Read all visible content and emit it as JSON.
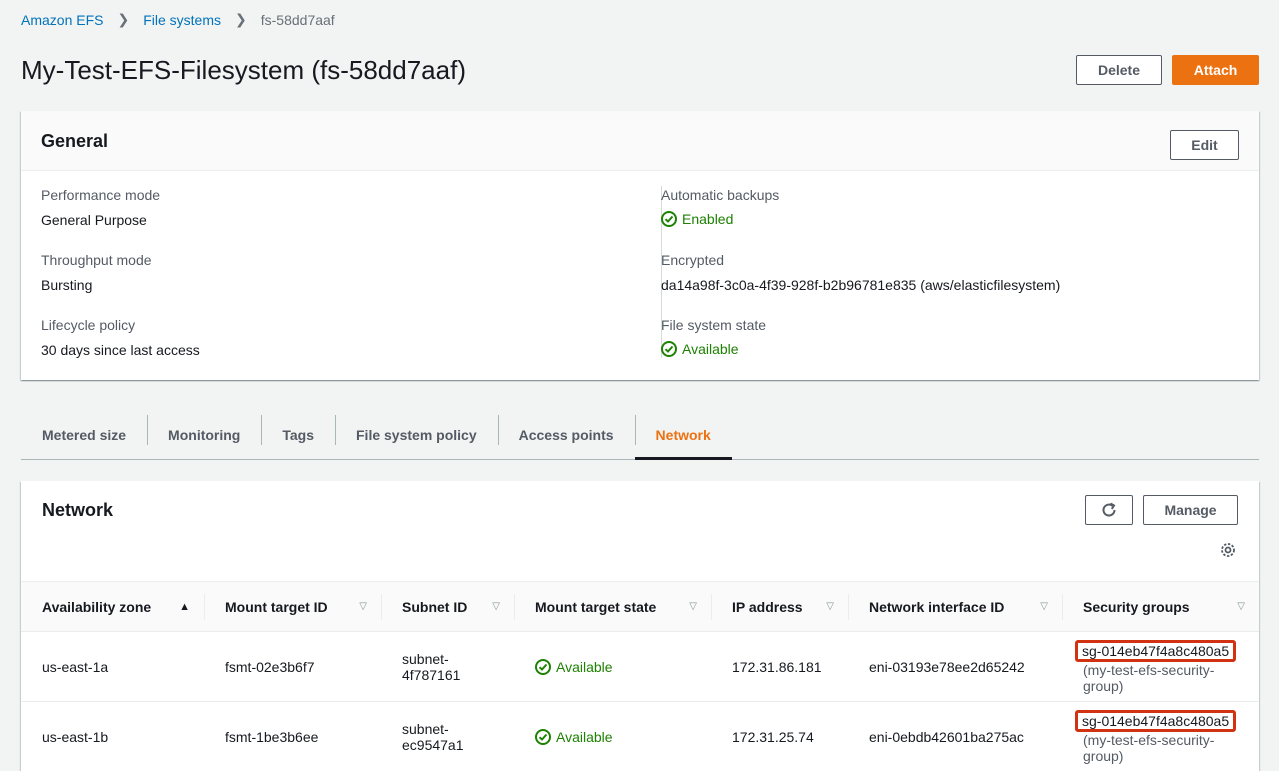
{
  "breadcrumb": [
    "Amazon EFS",
    "File systems",
    "fs-58dd7aaf"
  ],
  "title": "My-Test-EFS-Filesystem (fs-58dd7aaf)",
  "actions": {
    "delete": "Delete",
    "attach": "Attach",
    "edit": "Edit"
  },
  "general": {
    "heading": "General",
    "performance_label": "Performance mode",
    "performance_value": "General Purpose",
    "throughput_label": "Throughput mode",
    "throughput_value": "Bursting",
    "lifecycle_label": "Lifecycle policy",
    "lifecycle_value": "30 days since last access",
    "backups_label": "Automatic backups",
    "backups_value": "Enabled",
    "encrypted_label": "Encrypted",
    "encrypted_value": "da14a98f-3c0a-4f39-928f-b2b96781e835 (aws/elasticfilesystem)",
    "state_label": "File system state",
    "state_value": "Available"
  },
  "tabs": [
    "Metered size",
    "Monitoring",
    "Tags",
    "File system policy",
    "Access points",
    "Network"
  ],
  "active_tab": "Network",
  "network": {
    "heading": "Network",
    "manage": "Manage",
    "columns": [
      "Availability zone",
      "Mount target ID",
      "Subnet ID",
      "Mount target state",
      "IP address",
      "Network interface ID",
      "Security groups"
    ],
    "rows": [
      {
        "az": "us-east-1a",
        "mount_target": "fsmt-02e3b6f7",
        "subnet_a": "subnet-",
        "subnet_b": "4f787161",
        "state": "Available",
        "ip": "172.31.86.181",
        "eni": "eni-03193e78ee2d65242",
        "sg": "sg-014eb47f4a8c480a5",
        "sg_name_a": "(my-test-efs-security-",
        "sg_name_b": "group)"
      },
      {
        "az": "us-east-1b",
        "mount_target": "fsmt-1be3b6ee",
        "subnet_a": "subnet-",
        "subnet_b": "ec9547a1",
        "state": "Available",
        "ip": "172.31.25.74",
        "eni": "eni-0ebdb42601ba275ac",
        "sg": "sg-014eb47f4a8c480a5",
        "sg_name_a": "(my-test-efs-security-",
        "sg_name_b": "group)"
      }
    ]
  },
  "colors": {
    "accent": "#ec7211",
    "link": "#0073bb",
    "success": "#1d8102",
    "highlight": "#d13212"
  }
}
